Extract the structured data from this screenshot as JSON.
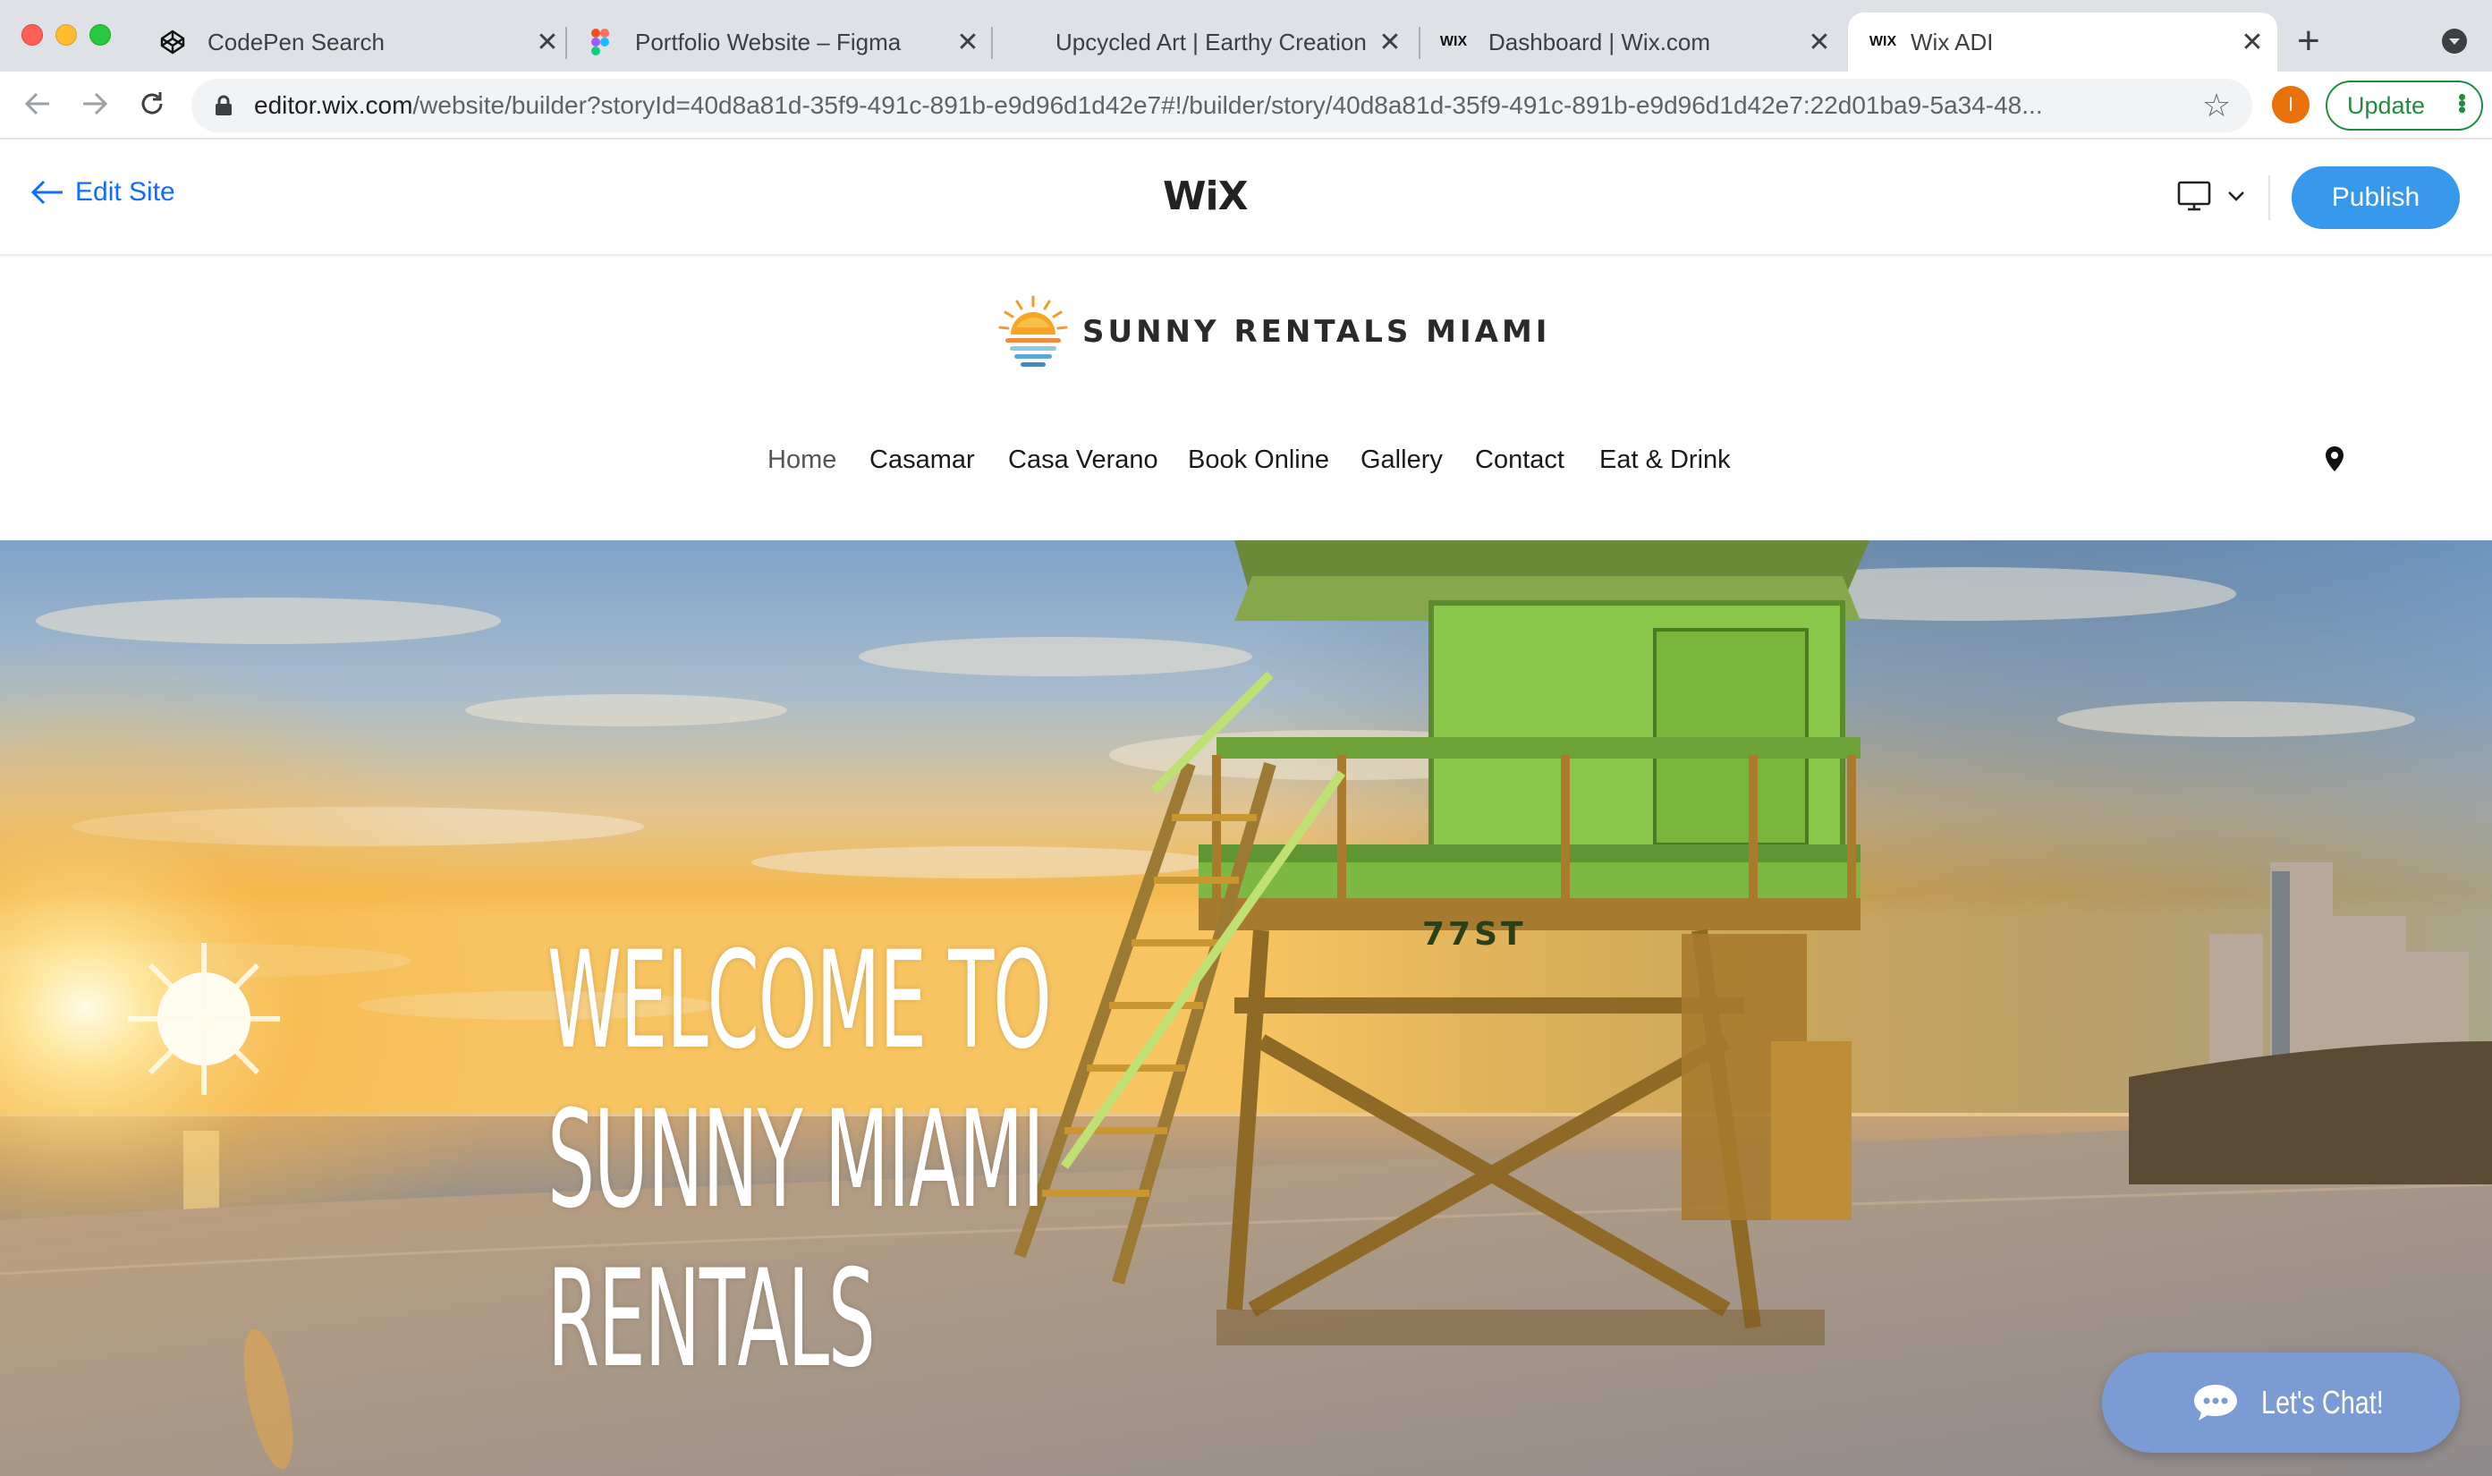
{
  "browser": {
    "tabs": [
      {
        "title": "CodePen Search",
        "favicon": "codepen-icon"
      },
      {
        "title": "Portfolio Website – Figma",
        "favicon": "figma-icon"
      },
      {
        "title": "Upcycled Art | Earthy Creations",
        "favicon": "none"
      },
      {
        "title": "Dashboard | Wix.com",
        "favicon": "wix-icon"
      },
      {
        "title": "Wix ADI",
        "favicon": "wix-icon",
        "active": true
      }
    ],
    "url_domain": "editor.wix.com",
    "url_path": "/website/builder?storyId=40d8a81d-35f9-491c-891b-e9d96d1d42e7#!/builder/story/40d8a81d-35f9-491c-891b-e9d96d1d42e7:22d01ba9-5a34-48...",
    "profile_initial": "I",
    "update_label": "Update",
    "colors": {
      "update": "#1e8e3e",
      "profile": "#e8710a"
    }
  },
  "editor": {
    "back_label": "Edit Site",
    "logo": "WiX",
    "device_icon": "desktop-icon",
    "publish_label": "Publish",
    "colors": {
      "link": "#116dff",
      "publish": "#3899ec"
    }
  },
  "site": {
    "brand_name": "SUNNY RENTALS MIAMI",
    "nav": [
      {
        "label": "Home",
        "active": true
      },
      {
        "label": "Casamar"
      },
      {
        "label": "Casa Verano"
      },
      {
        "label": "Book Online"
      },
      {
        "label": "Gallery"
      },
      {
        "label": "Contact"
      },
      {
        "label": "Eat & Drink"
      }
    ],
    "location_icon": "map-pin-icon",
    "hero": {
      "lines": [
        "WELCOME TO",
        "SUNNY MIAMI",
        "RENTALS"
      ],
      "tower_label": "77ST"
    },
    "chat_label": "Let's Chat!",
    "colors": {
      "chat": "#7b9bd4"
    }
  }
}
